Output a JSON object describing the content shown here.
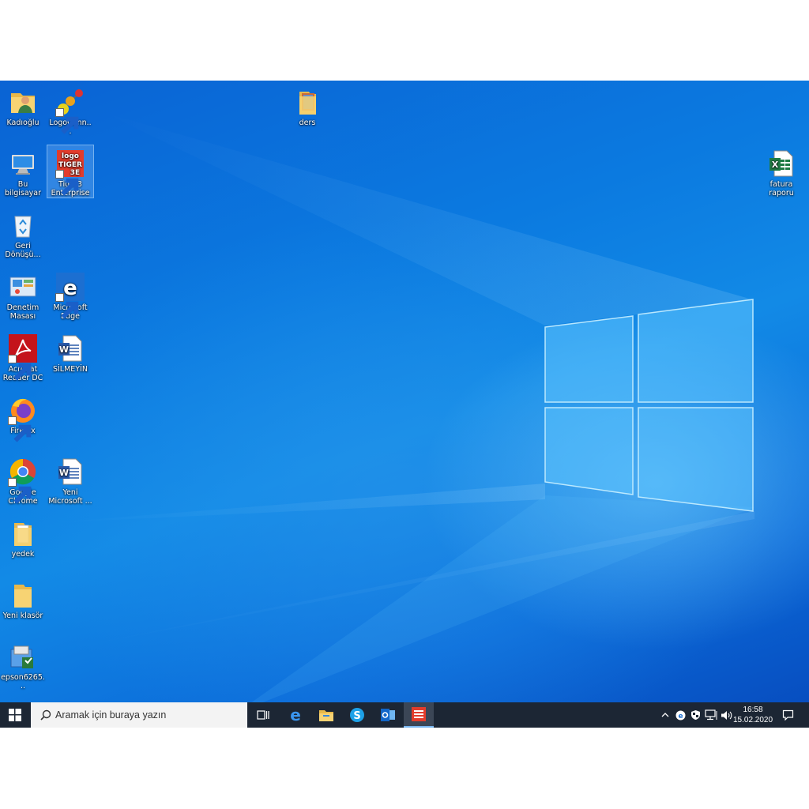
{
  "desktop": {
    "icons": [
      {
        "label": "Kadıoğlu",
        "icon": "user-folder-icon"
      },
      {
        "label": "LogoConn...",
        "icon": "logo-connect-icon"
      },
      {
        "label": "ders",
        "icon": "folder-icon"
      },
      {
        "label": "Bu bilgisayar",
        "icon": "computer-icon"
      },
      {
        "label": "Tiger3 Enterprise",
        "icon": "logo-tiger-icon"
      },
      {
        "label": "fatura raporu",
        "icon": "excel-icon"
      },
      {
        "label": "Geri Dönüşü...",
        "icon": "recycle-bin-icon"
      },
      {
        "label": "Denetim Masası",
        "icon": "control-panel-icon"
      },
      {
        "label": "Microsoft Edge",
        "icon": "edge-icon"
      },
      {
        "label": "Acrobat Reader DC",
        "icon": "acrobat-icon"
      },
      {
        "label": "SİLMEYİN",
        "icon": "word-icon"
      },
      {
        "label": "Firefox",
        "icon": "firefox-icon"
      },
      {
        "label": "Google Chrome",
        "icon": "chrome-icon"
      },
      {
        "label": "Yeni Microsoft ...",
        "icon": "word-icon"
      },
      {
        "label": "yedek",
        "icon": "folder-icon"
      },
      {
        "label": "Yeni klasör",
        "icon": "folder-icon"
      },
      {
        "label": "epson6265...",
        "icon": "installer-icon"
      }
    ],
    "logo_text_line1": "logo",
    "logo_text_line2": "TIGER",
    "logo_text_line3": "3E"
  },
  "taskbar": {
    "search_placeholder": "Aramak için buraya yazın",
    "apps": [
      "task-view-icon",
      "edge-icon",
      "file-explorer-icon",
      "skype-icon",
      "outlook-icon",
      "logo-tiger-icon"
    ],
    "active_app": "logo-tiger-icon",
    "tray": [
      "chevron-up-icon",
      "edge-tray-icon",
      "security-icon",
      "network-icon",
      "volume-icon"
    ],
    "time": "16:58",
    "date": "15.02.2020",
    "notification_icon": "action-center-icon"
  },
  "colors": {
    "desktop_blue": "#0b7ae0",
    "taskbar": "#1c2634",
    "active_indicator": "#79b8f3"
  }
}
